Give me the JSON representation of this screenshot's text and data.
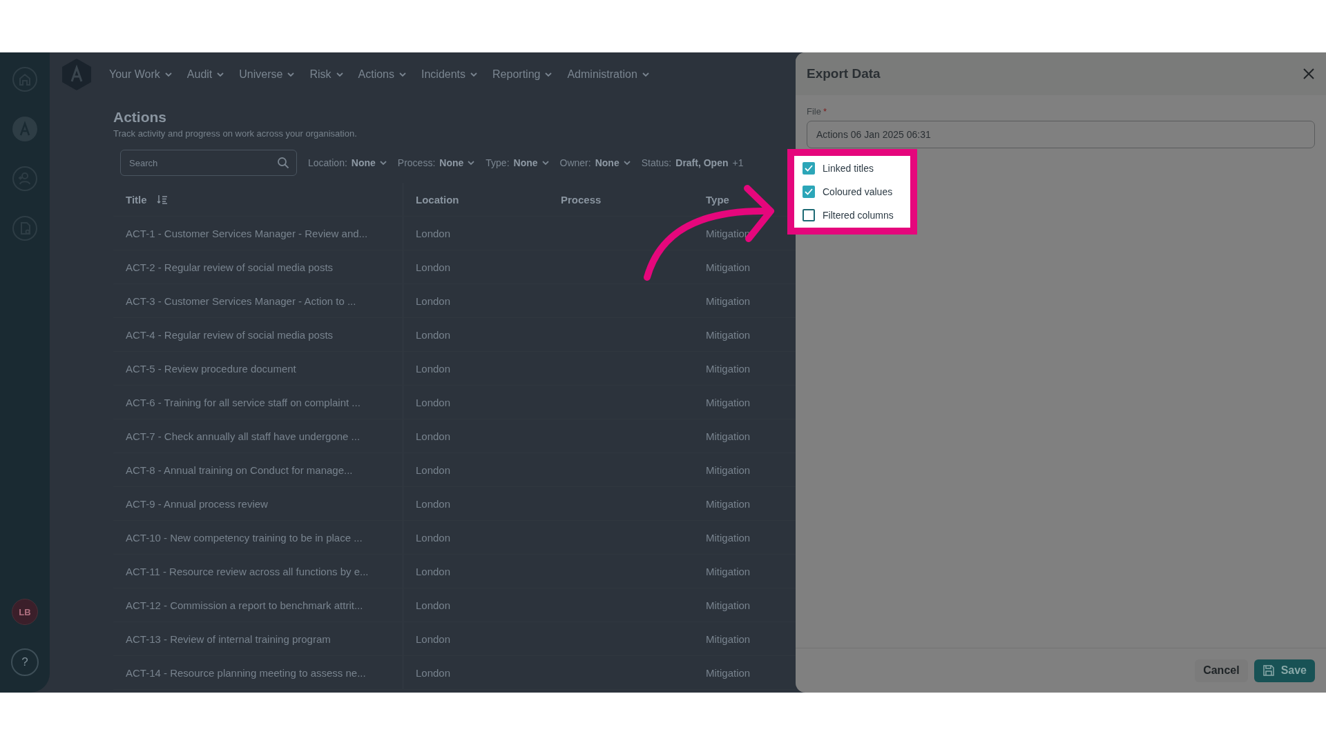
{
  "sidebar": {
    "icons": [
      {
        "kind": "home"
      },
      {
        "kind": "logo"
      },
      {
        "kind": "people"
      },
      {
        "kind": "document"
      }
    ],
    "avatar": "LB",
    "help": "?"
  },
  "nav": {
    "items": [
      "Your Work",
      "Audit",
      "Universe",
      "Risk",
      "Actions",
      "Incidents",
      "Reporting",
      "Administration"
    ]
  },
  "page": {
    "title": "Actions",
    "subtitle": "Track activity and progress on work across your organisation."
  },
  "search": {
    "placeholder": "Search"
  },
  "filters": [
    {
      "label": "Location:",
      "value": "None"
    },
    {
      "label": "Process:",
      "value": "None"
    },
    {
      "label": "Type:",
      "value": "None"
    },
    {
      "label": "Owner:",
      "value": "None"
    },
    {
      "label": "Status:",
      "value": "Draft, Open",
      "extra": "+1"
    }
  ],
  "table": {
    "columns": [
      "Title",
      "Location",
      "Process",
      "Type"
    ],
    "rows": [
      {
        "title": "ACT-1 - Customer Services Manager - Review and...",
        "location": "London",
        "type": "Mitigation"
      },
      {
        "title": "ACT-2 - Regular review of social media posts",
        "location": "London",
        "type": "Mitigation"
      },
      {
        "title": "ACT-3 - Customer Services Manager - Action to ...",
        "location": "London",
        "type": "Mitigation"
      },
      {
        "title": "ACT-4 - Regular review of social media posts",
        "location": "London",
        "type": "Mitigation"
      },
      {
        "title": "ACT-5 - Review procedure document",
        "location": "London",
        "type": "Mitigation"
      },
      {
        "title": "ACT-6 - Training for all service staff on complaint ...",
        "location": "London",
        "type": "Mitigation"
      },
      {
        "title": "ACT-7 - Check annually all staff have undergone ...",
        "location": "London",
        "type": "Mitigation"
      },
      {
        "title": "ACT-8 - Annual training on Conduct for manage...",
        "location": "London",
        "type": "Mitigation"
      },
      {
        "title": "ACT-9 - Annual process review",
        "location": "London",
        "type": "Mitigation"
      },
      {
        "title": "ACT-10 - New competency training to be in place ...",
        "location": "London",
        "type": "Mitigation"
      },
      {
        "title": "ACT-11 - Resource review across all functions by e...",
        "location": "London",
        "type": "Mitigation"
      },
      {
        "title": "ACT-12 - Commission a report to benchmark attrit...",
        "location": "London",
        "type": "Mitigation"
      },
      {
        "title": "ACT-13 - Review of internal training program",
        "location": "London",
        "type": "Mitigation"
      },
      {
        "title": "ACT-14 - Resource planning meeting to assess ne...",
        "location": "London",
        "type": "Mitigation"
      }
    ]
  },
  "export_panel": {
    "title": "Export Data",
    "file_label": "File",
    "required_mark": "*",
    "file_value": "Actions 06 Jan 2025 06:31",
    "options": [
      {
        "label": "Linked titles",
        "checked": true
      },
      {
        "label": "Coloured values",
        "checked": true
      },
      {
        "label": "Filtered columns",
        "checked": false
      }
    ],
    "cancel": "Cancel",
    "save": "Save"
  }
}
